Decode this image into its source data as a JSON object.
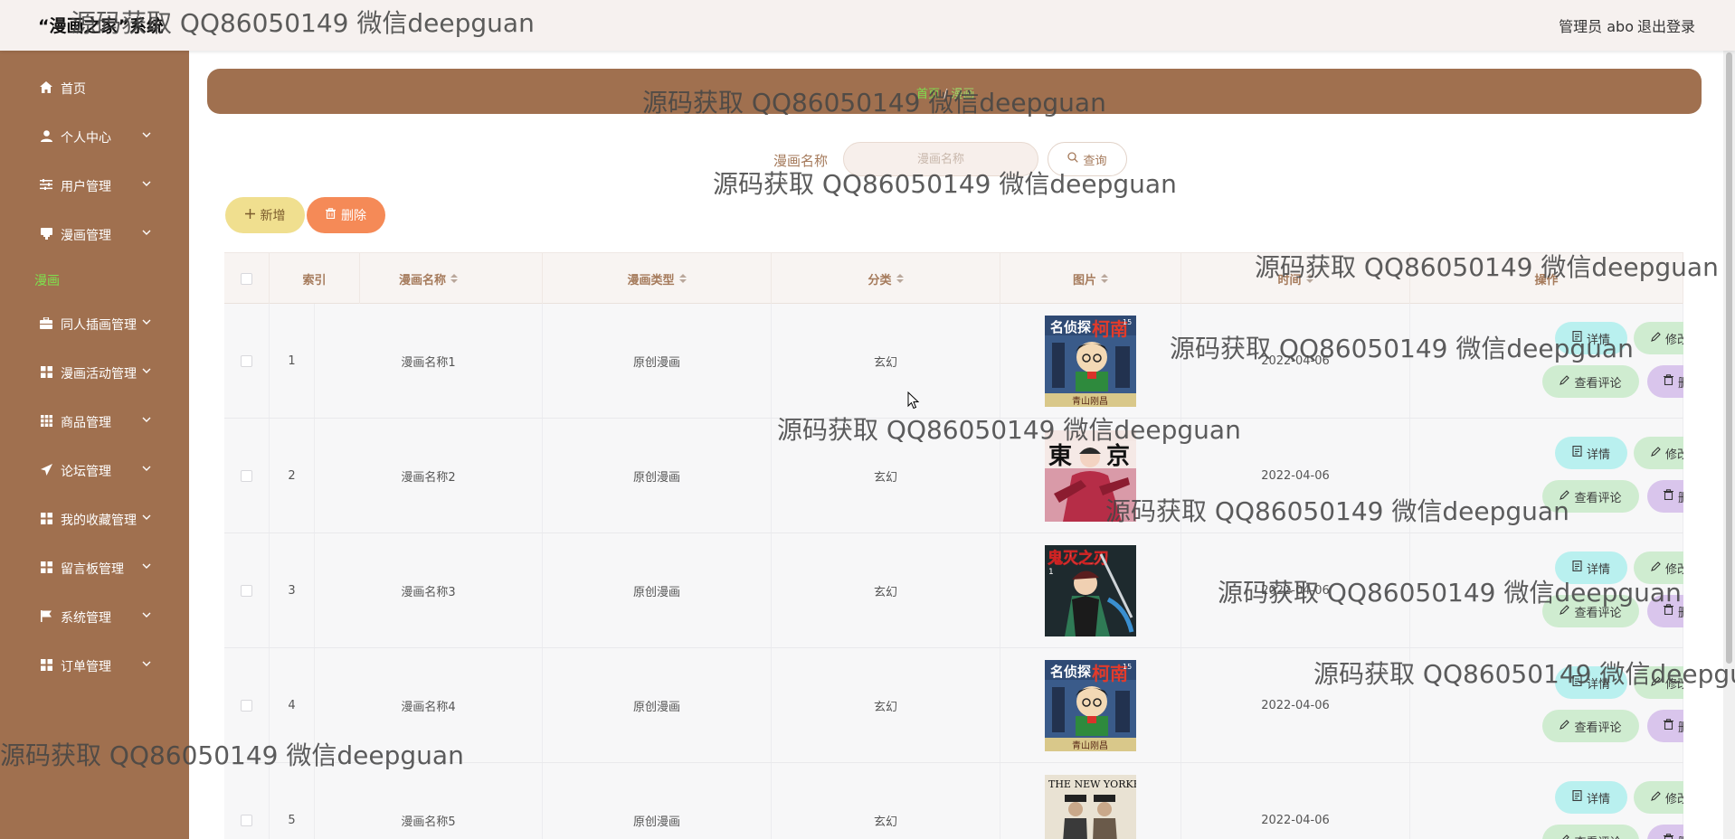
{
  "header": {
    "title": "“漫画之家”系统",
    "user": "管理员 abo",
    "logout": "退出登录"
  },
  "sidebar": {
    "items": [
      {
        "label": "首页",
        "icon": "home-icon"
      },
      {
        "label": "个人中心",
        "icon": "user-icon"
      },
      {
        "label": "用户管理",
        "icon": "sliders-icon"
      },
      {
        "label": "漫画管理",
        "icon": "book-icon"
      },
      {
        "label": "同人插画管理",
        "icon": "briefcase-icon"
      },
      {
        "label": "漫画活动管理",
        "icon": "grid-icon"
      },
      {
        "label": "商品管理",
        "icon": "grid-dots-icon"
      },
      {
        "label": "论坛管理",
        "icon": "send-icon"
      },
      {
        "label": "我的收藏管理",
        "icon": "grid-icon"
      },
      {
        "label": "留言板管理",
        "icon": "grid-icon"
      },
      {
        "label": "系统管理",
        "icon": "flag-icon"
      },
      {
        "label": "订单管理",
        "icon": "grid-icon"
      }
    ],
    "active_sub": "漫画"
  },
  "breadcrumb": {
    "home": "首页",
    "sep": "/",
    "current": "漫画"
  },
  "search": {
    "label": "漫画名称",
    "placeholder": "漫画名称",
    "button": "查询"
  },
  "toolbar": {
    "add": "新增",
    "delete": "删除"
  },
  "table": {
    "columns": [
      "索引",
      "漫画名称",
      "漫画类型",
      "分类",
      "图片",
      "时间",
      "操作"
    ],
    "rows": [
      {
        "index": "1",
        "name": "漫画名称1",
        "type": "原创漫画",
        "category": "玄幻",
        "image": "conan-cover",
        "time": "2022-04-06"
      },
      {
        "index": "2",
        "name": "漫画名称2",
        "type": "原创漫画",
        "category": "玄幻",
        "image": "tokyo-cover",
        "time": "2022-04-06"
      },
      {
        "index": "3",
        "name": "漫画名称3",
        "type": "原创漫画",
        "category": "玄幻",
        "image": "kimetsu-cover",
        "time": "2022-04-06"
      },
      {
        "index": "4",
        "name": "漫画名称4",
        "type": "原创漫画",
        "category": "玄幻",
        "image": "conan-cover",
        "time": "2022-04-06"
      },
      {
        "index": "5",
        "name": "漫画名称5",
        "type": "原创漫画",
        "category": "玄幻",
        "image": "new-yorker-cover",
        "time": "2022-04-06"
      }
    ],
    "actions": {
      "detail": "详情",
      "edit": "修改",
      "comment": "查看评论",
      "delete": "删除"
    }
  },
  "covers": {
    "conan": {
      "masthead": "名侦探",
      "big": "柯南",
      "author": "青山刚昌",
      "num": "15"
    },
    "tokyo": {
      "big1": "東",
      "big2": "京"
    },
    "kimetsu": {
      "big": "鬼灭之刃",
      "num": "1"
    },
    "newyorker": {
      "masthead": "THE NEW YORKER"
    }
  },
  "watermark": "源码获取 QQ86050149 微信deepguan",
  "colors": {
    "sidebar": "#a0704f",
    "accent_green": "#7ee04e",
    "header_text": "#a57a5b",
    "add_button": "#f0df8f",
    "delete_button": "#f58a57"
  }
}
